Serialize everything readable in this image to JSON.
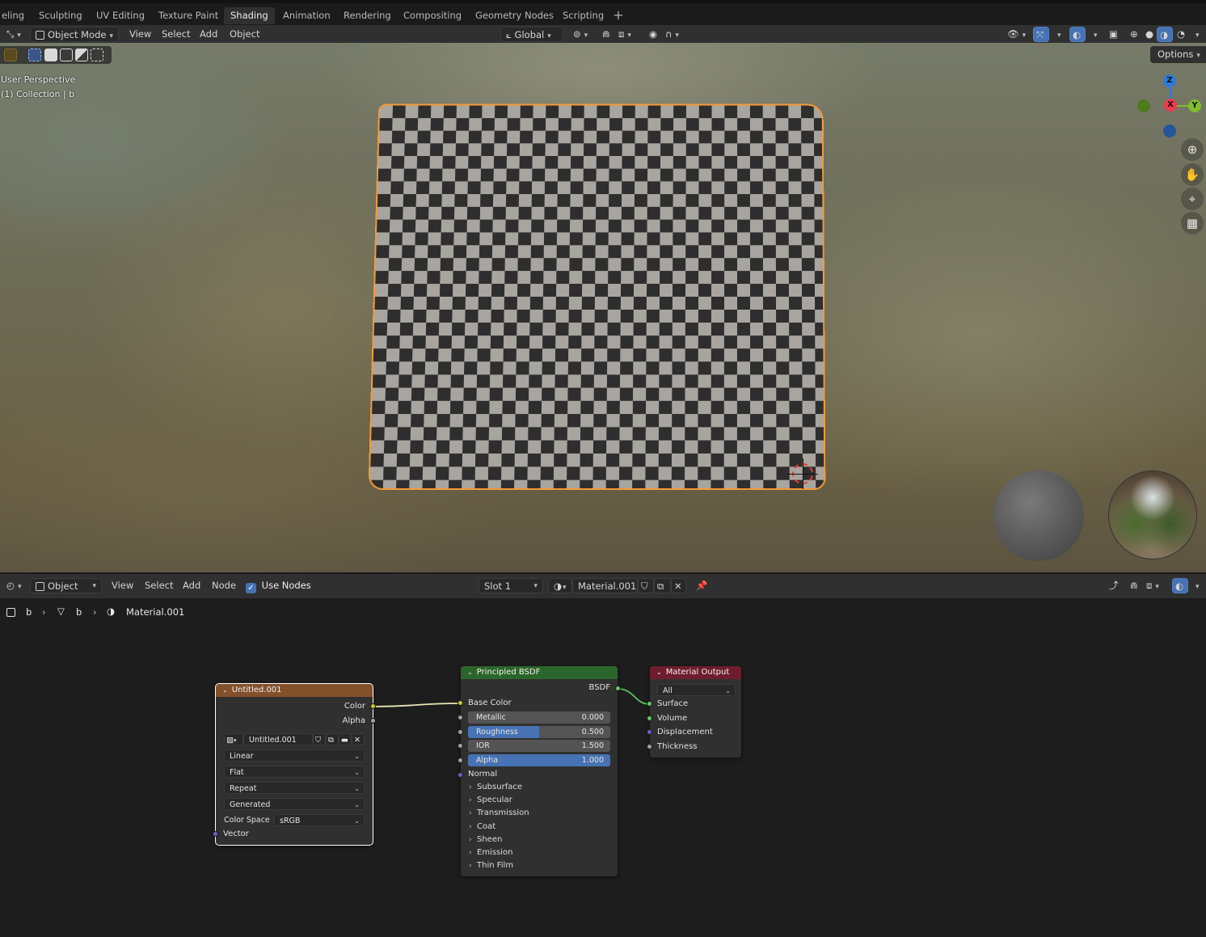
{
  "workspace_tabs": [
    {
      "label": "eling",
      "active": false
    },
    {
      "label": "Sculpting",
      "active": false
    },
    {
      "label": "UV Editing",
      "active": false
    },
    {
      "label": "Texture Paint",
      "active": false
    },
    {
      "label": "Shading",
      "active": true
    },
    {
      "label": "Animation",
      "active": false
    },
    {
      "label": "Rendering",
      "active": false
    },
    {
      "label": "Compositing",
      "active": false
    },
    {
      "label": "Geometry Nodes",
      "active": false
    },
    {
      "label": "Scripting",
      "active": false
    }
  ],
  "workspace_add": "+",
  "viewport_header": {
    "mode": "Object Mode",
    "menus": [
      "View",
      "Select",
      "Add",
      "Object"
    ],
    "transform_orientation": "Global"
  },
  "viewport": {
    "perspective_label": "User Perspective",
    "collection_label": "(1) Collection | b",
    "options_label": "Options",
    "gizmo_axes": {
      "z": "Z",
      "x": "X",
      "y": "Y"
    },
    "colors": {
      "x": "#ee3a4d",
      "y": "#7cbe2b",
      "z": "#2e7bd8",
      "selection": "#f39a3a"
    }
  },
  "node_header": {
    "editor_type": "Object",
    "menus": [
      "View",
      "Select",
      "Add",
      "Node"
    ],
    "use_nodes_label": "Use Nodes",
    "use_nodes_checked": true,
    "slot": "Slot 1",
    "material_name": "Material.001"
  },
  "breadcrumb": {
    "object": "b",
    "mesh": "b",
    "material": "Material.001"
  },
  "nodes": {
    "image_texture": {
      "title": "Untitled.001",
      "outputs": {
        "color": "Color",
        "alpha": "Alpha"
      },
      "image_name": "Untitled.001",
      "interpolation": "Linear",
      "projection": "Flat",
      "extension": "Repeat",
      "source": "Generated",
      "color_space_label": "Color Space",
      "color_space": "sRGB",
      "input_vector": "Vector",
      "header_color": "#83502c"
    },
    "principled": {
      "title": "Principled BSDF",
      "output": "BSDF",
      "base_color": "Base Color",
      "metallic_label": "Metallic",
      "metallic": "0.000",
      "roughness_label": "Roughness",
      "roughness": "0.500",
      "roughness_fraction": 0.5,
      "ior_label": "IOR",
      "ior": "1.500",
      "alpha_label": "Alpha",
      "alpha": "1.000",
      "normal": "Normal",
      "panels": [
        "Subsurface",
        "Specular",
        "Transmission",
        "Coat",
        "Sheen",
        "Emission",
        "Thin Film"
      ],
      "header_color": "#2b652b"
    },
    "material_output": {
      "title": "Material Output",
      "target": "All",
      "inputs": [
        "Surface",
        "Volume",
        "Displacement",
        "Thickness"
      ],
      "header_color": "#6e1d2f"
    }
  }
}
